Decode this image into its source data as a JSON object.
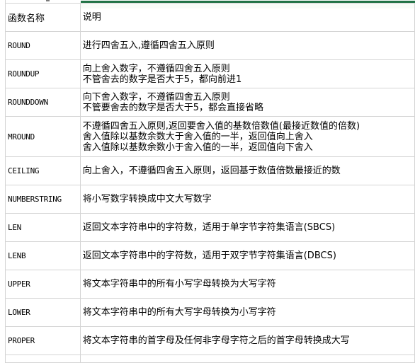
{
  "sheet": {
    "accent_color": "#217346",
    "headers": {
      "name": "函数名称",
      "description": "说明"
    },
    "rows": [
      {
        "name": "ROUND",
        "lines": [
          "进行四舍五入,遵循四舍五入原则"
        ]
      },
      {
        "name": "ROUNDUP",
        "lines": [
          "向上舍入数字，不遵循四舍五入原则",
          "不管舍去的数字是否大于5，都向前进1"
        ]
      },
      {
        "name": "ROUNDDOWN",
        "lines": [
          "向下舍入数字，不遵循四舍五入原则",
          "不管要舍去的数字是否大于5，都会直接省略"
        ]
      },
      {
        "name": "MROUND",
        "lines": [
          "不遵循四舍五入原则,返回要舍入值的基数倍数值(最接近数值的倍数)",
          "舍入值除以基数余数大于舍入值的一半，返回值向上舍入",
          "舍入值除以基数余数小于舍入值的一半，返回值向下舍入"
        ]
      },
      {
        "name": "CEILING",
        "lines": [
          "向上舍入，不遵循四舍五入原则，返回基于数值倍数最接近的数"
        ]
      },
      {
        "name": "NUMBERSTRING",
        "lines": [
          "将小写数字转换成中文大写数字"
        ]
      },
      {
        "name": "LEN",
        "lines": [
          "返回文本字符串中的字符数，适用于单字节字符集语言(SBCS)"
        ]
      },
      {
        "name": "LENB",
        "lines": [
          "返回文本字符串中的字符数，适用于双字节字符集语言(DBCS)"
        ]
      },
      {
        "name": "UPPER",
        "lines": [
          "将文本字符串中的所有小写字母转换为大写字符"
        ]
      },
      {
        "name": "LOWER",
        "lines": [
          "将文本字符串中的所有大写字母转换为小写字符"
        ]
      },
      {
        "name": "PROPER",
        "lines": [
          "将文本字符串的首字母及任何非字母字符之后的首字母转换成大写"
        ]
      }
    ]
  }
}
